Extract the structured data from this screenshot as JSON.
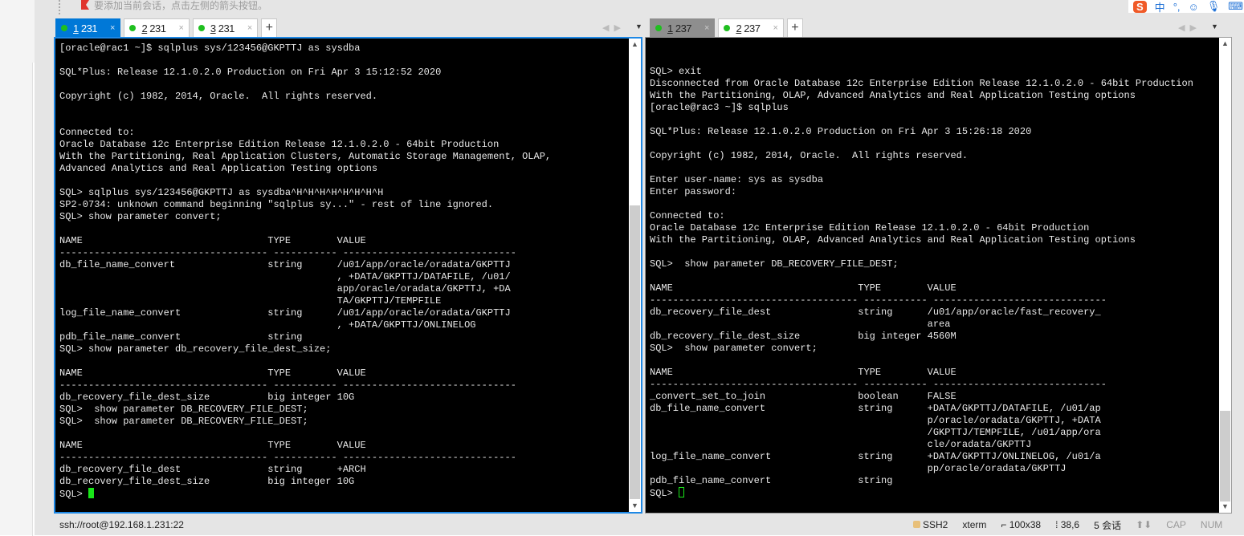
{
  "top_hint": "要添加当前会话，点击左侧的箭头按钮。",
  "ime": {
    "logo": "S",
    "mode": "中",
    "punct": "°,"
  },
  "left_tabs": [
    {
      "num": "1",
      "label": " 231",
      "status": "connected"
    },
    {
      "num": "2",
      "label": " 231",
      "status": "connected"
    },
    {
      "num": "3",
      "label": " 231",
      "status": "connected"
    }
  ],
  "right_tabs": [
    {
      "num": "1",
      "label": " 237",
      "status": "connected"
    },
    {
      "num": "2",
      "label": " 237",
      "status": "connected"
    }
  ],
  "close_glyph": "×",
  "add_tab": "+",
  "left_terminal": {
    "lines": [
      "[oracle@rac1 ~]$ sqlplus sys/123456@GKPTTJ as sysdba",
      "",
      "SQL*Plus: Release 12.1.0.2.0 Production on Fri Apr 3 15:12:52 2020",
      "",
      "Copyright (c) 1982, 2014, Oracle.  All rights reserved.",
      "",
      "",
      "Connected to:",
      "Oracle Database 12c Enterprise Edition Release 12.1.0.2.0 - 64bit Production",
      "With the Partitioning, Real Application Clusters, Automatic Storage Management, OLAP,",
      "Advanced Analytics and Real Application Testing options",
      "",
      "SQL> sqlplus sys/123456@GKPTTJ as sysdba^H^H^H^H^H^H^H^H",
      "SP2-0734: unknown command beginning \"sqlplus sy...\" - rest of line ignored.",
      "SQL> show parameter convert;",
      "",
      "NAME                                TYPE        VALUE",
      "------------------------------------ ----------- ------------------------------",
      "db_file_name_convert                string      /u01/app/oracle/oradata/GKPTTJ",
      "                                                , +DATA/GKPTTJ/DATAFILE, /u01/",
      "                                                app/oracle/oradata/GKPTTJ, +DA",
      "                                                TA/GKPTTJ/TEMPFILE",
      "log_file_name_convert               string      /u01/app/oracle/oradata/GKPTTJ",
      "                                                , +DATA/GKPTTJ/ONLINELOG",
      "pdb_file_name_convert               string",
      "SQL> show parameter db_recovery_file_dest_size;",
      "",
      "NAME                                TYPE        VALUE",
      "------------------------------------ ----------- ------------------------------",
      "db_recovery_file_dest_size          big integer 10G",
      "SQL>  show parameter DB_RECOVERY_FILE_DEST;",
      "SQL>  show parameter DB_RECOVERY_FILE_DEST;",
      "",
      "NAME                                TYPE        VALUE",
      "------------------------------------ ----------- ------------------------------",
      "db_recovery_file_dest               string      +ARCH",
      "db_recovery_file_dest_size          big integer 10G"
    ],
    "prompt": "SQL> ",
    "scroll_position": 0.55
  },
  "right_terminal": {
    "lines": [
      "",
      "",
      "SQL> exit",
      "Disconnected from Oracle Database 12c Enterprise Edition Release 12.1.0.2.0 - 64bit Production",
      "With the Partitioning, OLAP, Advanced Analytics and Real Application Testing options",
      "[oracle@rac3 ~]$ sqlplus",
      "",
      "SQL*Plus: Release 12.1.0.2.0 Production on Fri Apr 3 15:26:18 2020",
      "",
      "Copyright (c) 1982, 2014, Oracle.  All rights reserved.",
      "",
      "Enter user-name: sys as sysdba",
      "Enter password:",
      "",
      "Connected to:",
      "Oracle Database 12c Enterprise Edition Release 12.1.0.2.0 - 64bit Production",
      "With the Partitioning, OLAP, Advanced Analytics and Real Application Testing options",
      "",
      "SQL>  show parameter DB_RECOVERY_FILE_DEST;",
      "",
      "NAME                                TYPE        VALUE",
      "------------------------------------ ----------- ------------------------------",
      "db_recovery_file_dest               string      /u01/app/oracle/fast_recovery_",
      "                                                area",
      "db_recovery_file_dest_size          big integer 4560M",
      "SQL>  show parameter convert;",
      "",
      "NAME                                TYPE        VALUE",
      "------------------------------------ ----------- ------------------------------",
      "_convert_set_to_join                boolean     FALSE",
      "db_file_name_convert                string      +DATA/GKPTTJ/DATAFILE, /u01/ap",
      "                                                p/oracle/oradata/GKPTTJ, +DATA",
      "                                                /GKPTTJ/TEMPFILE, /u01/app/ora",
      "                                                cle/oradata/GKPTTJ",
      "log_file_name_convert               string      +DATA/GKPTTJ/ONLINELOG, /u01/a",
      "                                                pp/oracle/oradata/GKPTTJ",
      "pdb_file_name_convert               string"
    ],
    "prompt": "SQL> ",
    "scroll_position": 0.95
  },
  "status": {
    "address": "ssh://root@192.168.1.231:22",
    "protocol": "SSH2",
    "terminal_type": "xterm",
    "size": "100x38",
    "cursor_pos": "38,6",
    "sessions": "5 会话",
    "cap": "CAP",
    "num": "NUM"
  },
  "colors": {
    "active_tab": "#0078d7",
    "cursor": "#19e619",
    "status_dot": "#1fbf1f"
  }
}
